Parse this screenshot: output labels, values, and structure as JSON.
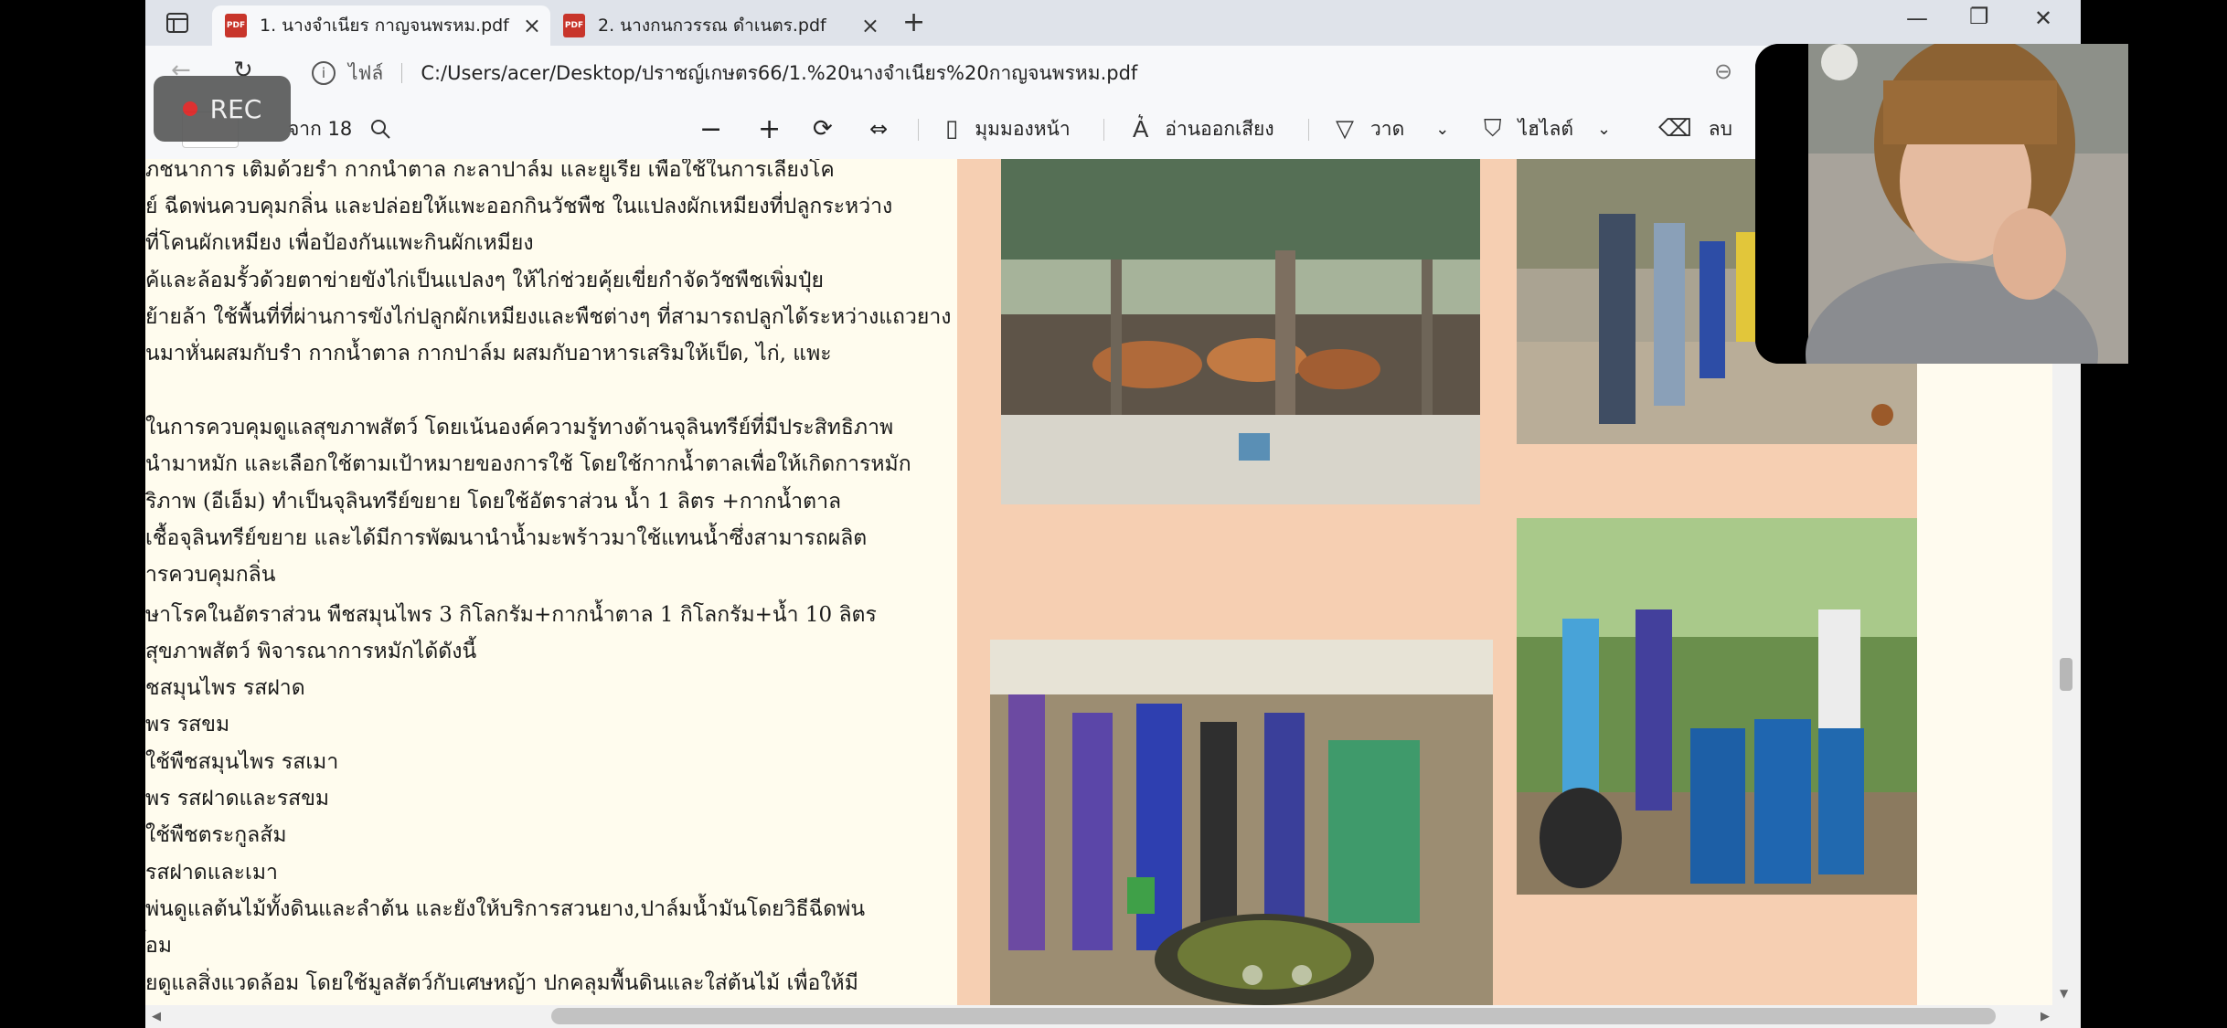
{
  "tabs": [
    {
      "label": "1. นางจำเนียร กาญจนพรหม.pdf",
      "active": true
    },
    {
      "label": "2. นางกนกวรรณ ดำเนตร.pdf",
      "active": false
    }
  ],
  "address": {
    "prefix": "ไฟล์",
    "url": "C:/Users/acer/Desktop/ปราชญ์เกษตร66/1.%20นางจำเนียร%20กาญจนพรหม.pdf"
  },
  "pdf_toolbar": {
    "page_total": "จาก 18",
    "page_view": "มุมมองหน้า",
    "read_aloud": "อ่านออกเสียง",
    "draw": "วาด",
    "highlight": "ไฮไลต์",
    "erase": "ลบ"
  },
  "recording": {
    "label": "REC"
  },
  "document_lines": [
    "ภชนาการ เติมด้วยรำ กากน้ำตาล กะลาปาล์ม และยูเรีย เพื่อใช้ในการเลี้ยงโค",
    "ย์ ฉีดพ่นควบคุมกลิ่น และปล่อยให้แพะออกกินวัชพืช ในแปลงผักเหมียงที่ปลูกระหว่าง",
    "ที่โคนผักเหมียง เพื่อป้องกันแพะกินผักเหมียง",
    "ค้และล้อมรั้วด้วยตาข่ายขังไก่เป็นแปลงๆ ให้ไก่ช่วยคุ้ยเขี่ยกำจัดวัชพืชเพิ่มปุ๋ย",
    "ย้ายล้า ใช้พื้นที่ที่ผ่านการขังไก่ปลูกผักเหมียงและพืชต่างๆ ที่สามารถปลูกได้ระหว่างแถวยาง",
    "นมาหั่นผสมกับรำ กากน้ำตาล กากปาล์ม ผสมกับอาหารเสริมให้เป็ด, ไก่, แพะ",
    "",
    "ในการควบคุมดูแลสุขภาพสัตว์ โดยเน้นองค์ความรู้ทางด้านจุลินทรีย์ที่มีประสิทธิภาพ",
    "นำมาหมัก และเลือกใช้ตามเป้าหมายของการใช้ โดยใช้กากน้ำตาลเพื่อให้เกิดการหมัก",
    "ริภาพ (อีเอ็ม) ทำเป็นจุลินทรีย์ขยาย โดยใช้อัตราส่วน น้ำ 1 ลิตร +กากน้ำตาล",
    "เชื้อจุลินทรีย์ขยาย และได้มีการพัฒนานำน้ำมะพร้าวมาใช้แทนน้ำซึ่งสามารถผลิต",
    "ารควบคุมกลิ่น",
    "ษาโรคในอัตราส่วน พืชสมุนไพร 3 กิโลกรัม+กากน้ำตาล 1 กิโลกรัม+น้ำ 10 ลิตร",
    "สุขภาพสัตว์ พิจารณาการหมักได้ดังนี้",
    "ชสมุนไพร รสฝาด",
    "พร รสขม",
    "ใช้พืชสมุนไพร รสเมา",
    "พร รสฝาดและรสขม",
    "ใช้พืชตระกูลส้ม",
    "รสฝาดและเมา",
    "พ่นดูแลต้นไม้ทั้งดินและลำต้น และยังให้บริการสวนยาง,ปาล์มน้ำมันโดยวิธีฉีดพ่น",
    "้อม",
    "ยดูแลสิ่งแวดล้อม โดยใช้มูลสัตว์กับเศษหญ้า ปกคลุมพื้นดินและใส่ต้นไม้ เพื่อให้มี"
  ],
  "icons": {
    "sidebar": "sidebar-toggle-icon",
    "back": "back-arrow-icon",
    "refresh": "refresh-icon",
    "info": "info-icon",
    "zoom": "zoom-icon",
    "search": "search-icon",
    "minus": "zoom-out-icon",
    "plus": "zoom-in-icon",
    "rotate": "rotate-icon",
    "fit": "fit-width-icon"
  },
  "colors": {
    "photo_panel": "#f6cfb2",
    "text_page": "#fffcee",
    "tab_strip": "#dfe3ea",
    "rec_dot": "#dd2222"
  }
}
